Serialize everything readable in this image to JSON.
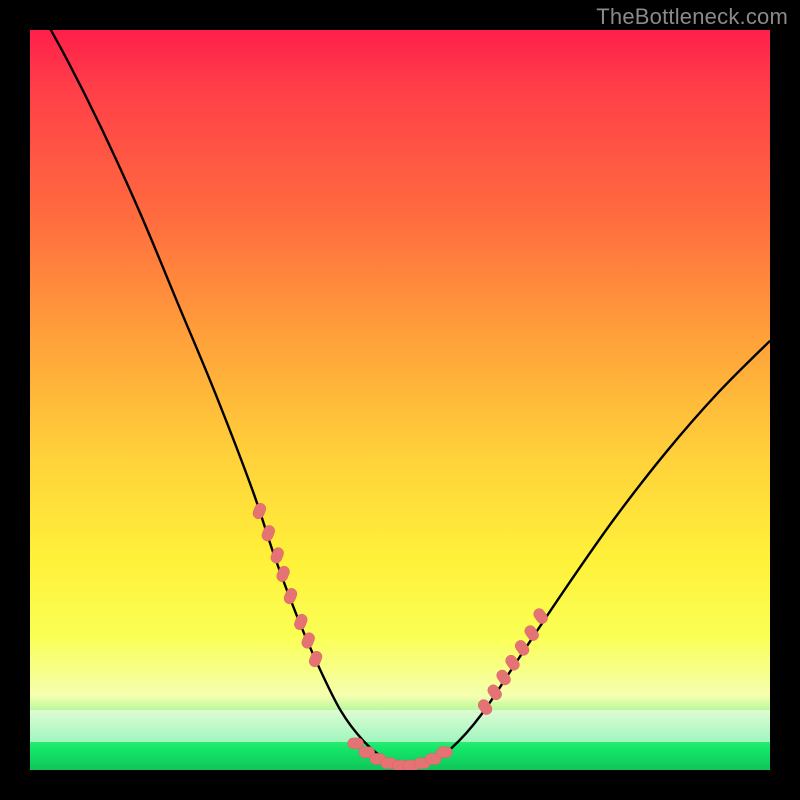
{
  "watermark": "TheBottleneck.com",
  "colors": {
    "background": "#000000",
    "curve": "#000000",
    "marker": "#e57373",
    "gradient_top": "#ff1f4b",
    "gradient_bottom": "#10c55a"
  },
  "chart_data": {
    "type": "line",
    "title": "",
    "xlabel": "",
    "ylabel": "",
    "xlim": [
      0,
      100
    ],
    "ylim": [
      0,
      100
    ],
    "curve": {
      "x": [
        0,
        5,
        10,
        15,
        20,
        25,
        30,
        33,
        36,
        39,
        42,
        45,
        48,
        51,
        54,
        57,
        61,
        66,
        72,
        79,
        86,
        93,
        100
      ],
      "y": [
        105,
        96,
        86,
        75,
        63,
        51,
        38,
        29,
        21,
        14,
        8,
        4,
        1.5,
        0.5,
        1.2,
        3,
        7.5,
        15,
        24,
        34,
        43,
        51,
        58
      ]
    },
    "markers_left": {
      "x": [
        31.0,
        32.2,
        33.4,
        34.2,
        35.2,
        36.6,
        37.6,
        38.6
      ],
      "y": [
        35.0,
        32.0,
        29.0,
        26.5,
        23.5,
        20.0,
        17.5,
        15.0
      ]
    },
    "markers_bottom": {
      "x": [
        44.0,
        45.5,
        47.0,
        48.5,
        50.0,
        51.5,
        53.0,
        54.5,
        56.0
      ],
      "y": [
        3.6,
        2.4,
        1.5,
        0.9,
        0.6,
        0.6,
        0.9,
        1.5,
        2.4
      ]
    },
    "markers_right": {
      "x": [
        61.5,
        62.8,
        64.0,
        65.2,
        66.5,
        67.8,
        69.0
      ],
      "y": [
        8.5,
        10.5,
        12.5,
        14.5,
        16.5,
        18.5,
        20.8
      ]
    }
  }
}
